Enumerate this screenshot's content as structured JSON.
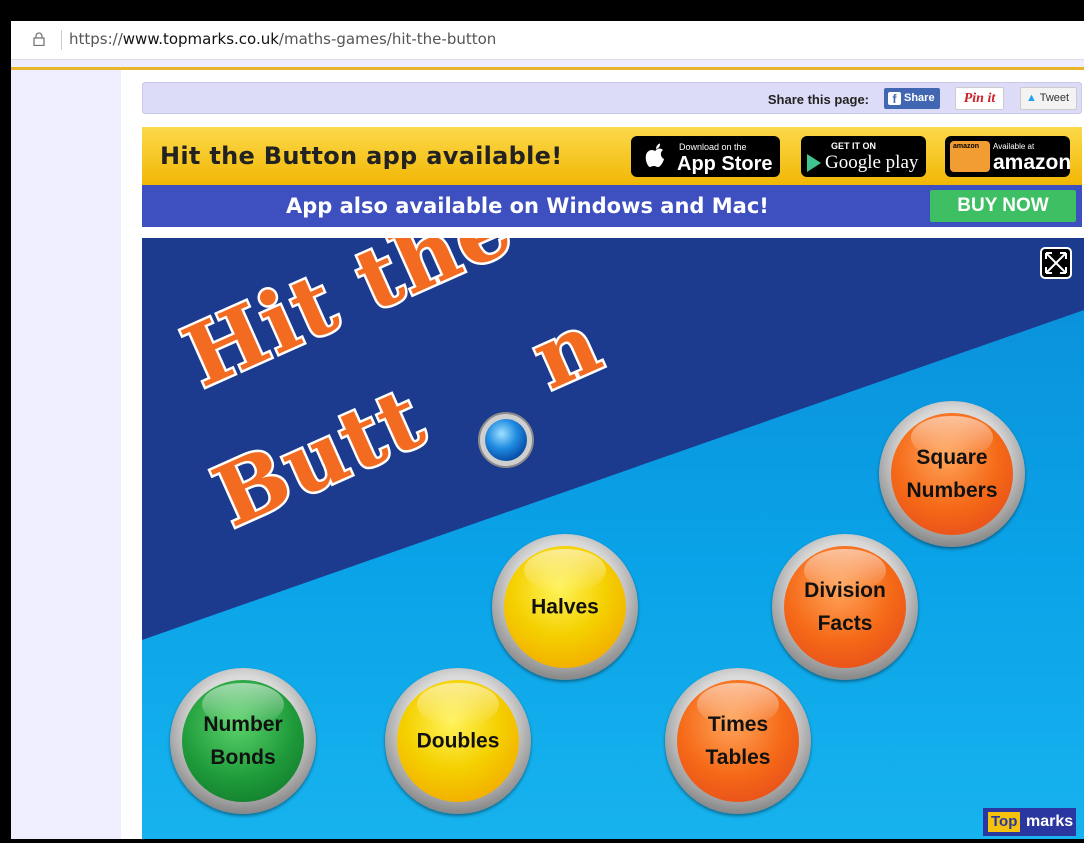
{
  "browser": {
    "url_prefix": "https://",
    "url_domain": "www.topmarks.co.uk",
    "url_path": "/maths-games/hit-the-button"
  },
  "share_bar": {
    "label": "Share this page:",
    "facebook": "Share",
    "pinterest": "Pin it",
    "twitter": "Tweet"
  },
  "app_banner": {
    "title": "Hit the Button app available!",
    "app_store_small": "Download on the",
    "app_store_big": "App Store",
    "google_small": "GET IT ON",
    "google_big": "Google play",
    "amazon_small": "Available at",
    "amazon_big": "amazon",
    "amazon_badge": "amazon"
  },
  "platform_banner": {
    "title": "App also available on Windows and Mac!",
    "buy_label": "BUY NOW"
  },
  "game": {
    "logo_line1": "Hit the",
    "logo_line2": "Butt",
    "logo_line2_end": "n",
    "buttons": [
      {
        "line1": "Square",
        "line2": "Numbers",
        "color": "orange"
      },
      {
        "line1": "Division",
        "line2": "Facts",
        "color": "orange"
      },
      {
        "line1": "Halves",
        "line2": "",
        "color": "yellow"
      },
      {
        "line1": "Number",
        "line2": "Bonds",
        "color": "green"
      },
      {
        "line1": "Doubles",
        "line2": "",
        "color": "yellow"
      },
      {
        "line1": "Times",
        "line2": "Tables",
        "color": "orange"
      }
    ],
    "brand_top": "Top",
    "brand_marks": "marks"
  },
  "colors": {
    "gold_banner": "#f2b705",
    "blue_banner": "#3e4fc0",
    "buy_green": "#3fbf64",
    "game_dark": "#1b3a8f",
    "game_light": "#0aa3e8",
    "logo_orange": "#f36b21"
  }
}
